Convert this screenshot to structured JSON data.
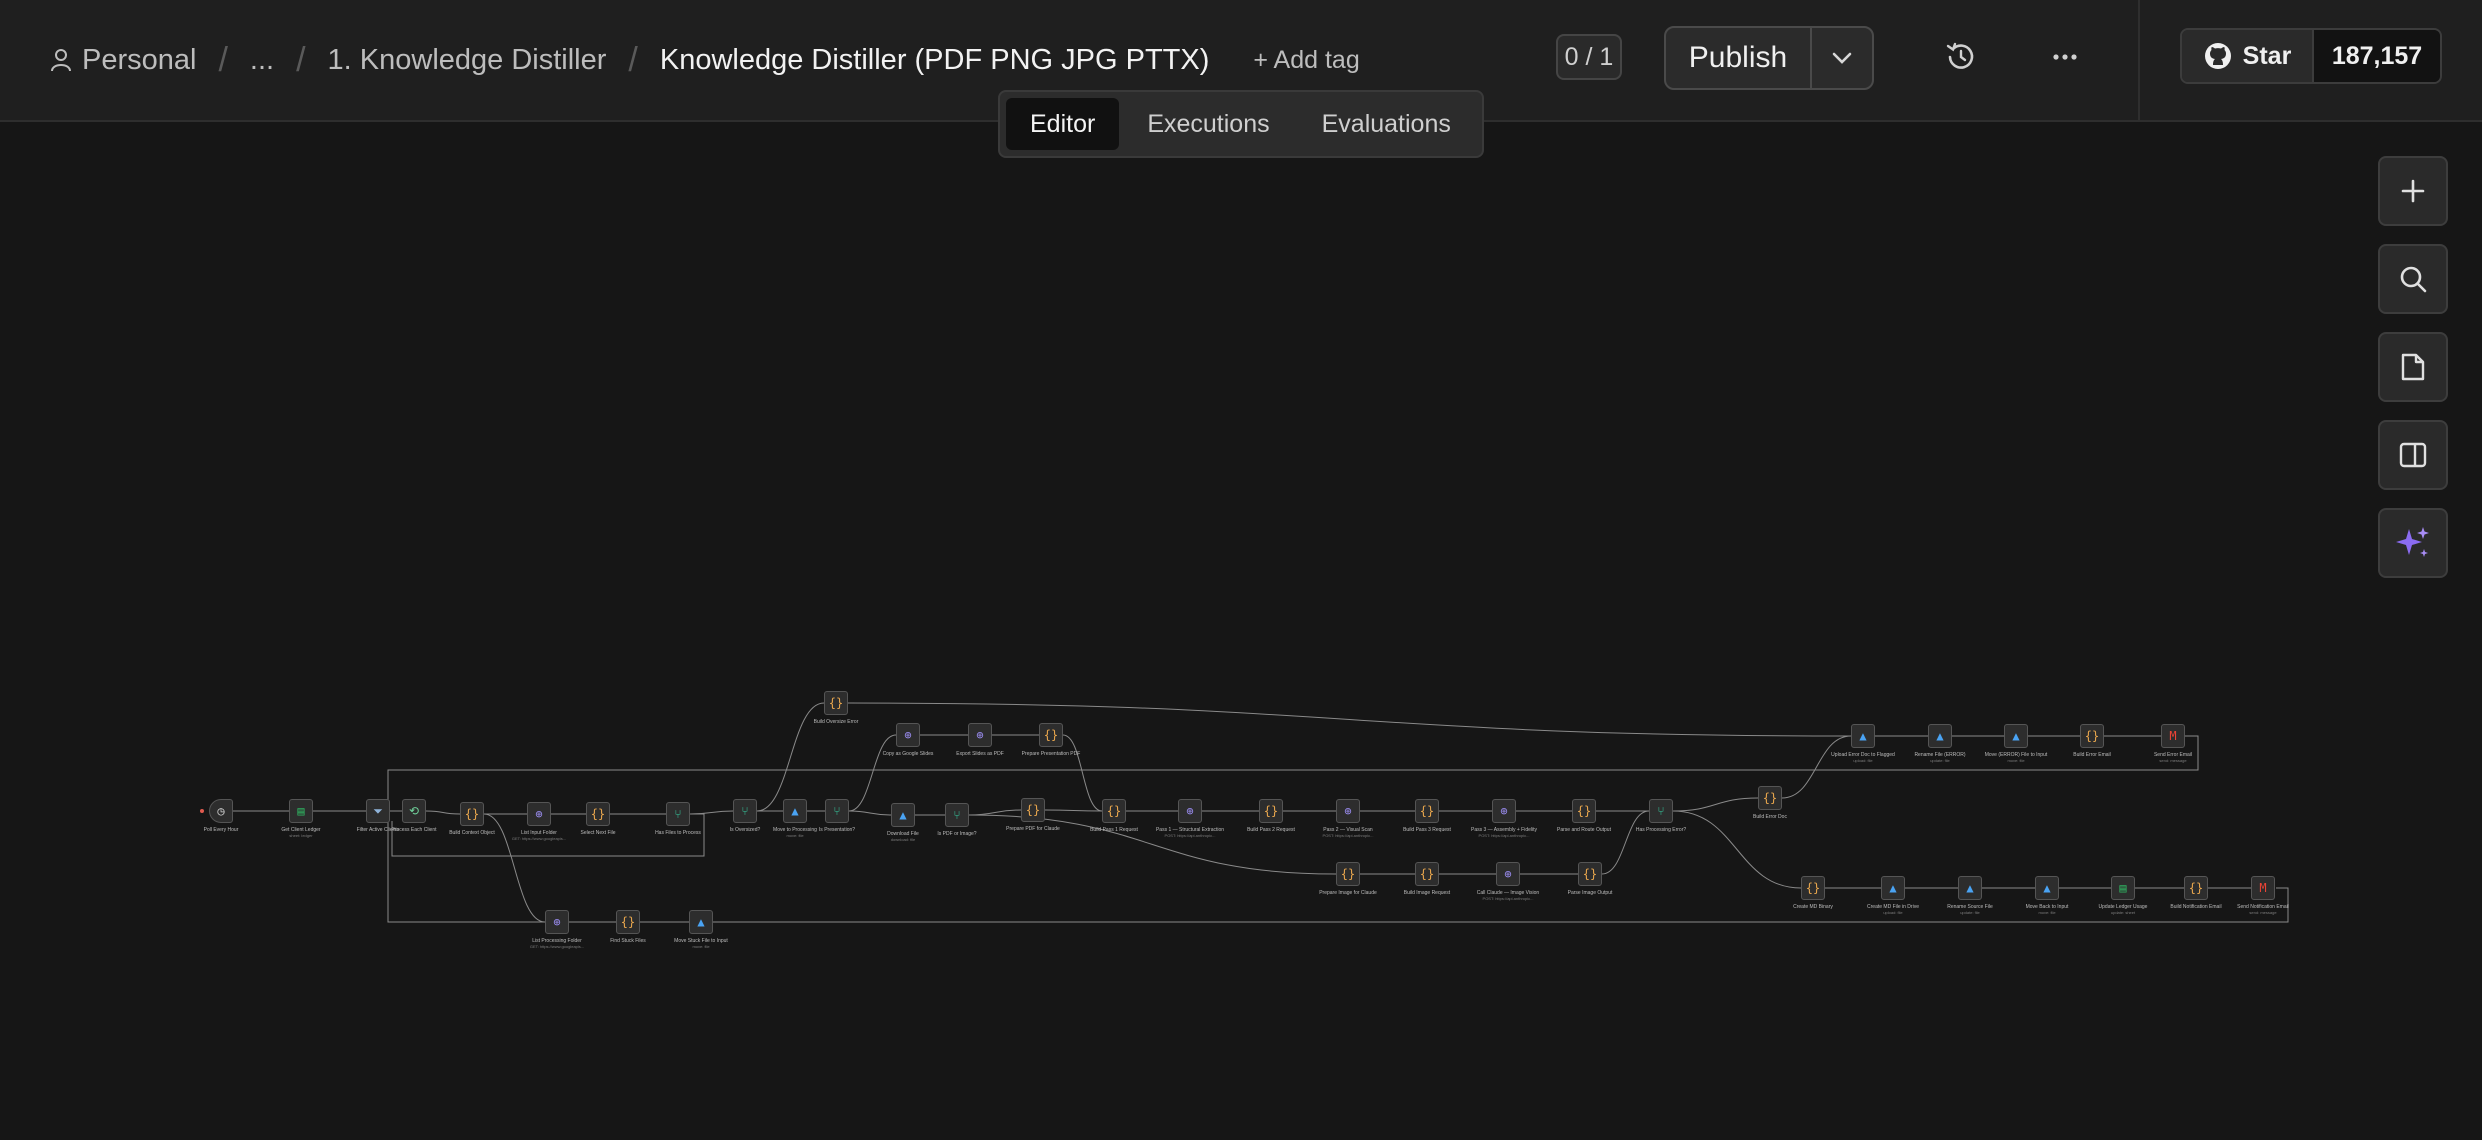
{
  "breadcrumb": {
    "personal": "Personal",
    "ellipsis": "...",
    "folder": "1. Knowledge Distiller",
    "workflow": "Knowledge Distiller (PDF PNG JPG PTTX)"
  },
  "header": {
    "add_tag": "+ Add tag",
    "counter": "0 / 1",
    "publish": "Publish",
    "github_star": "Star",
    "github_count": "187,157"
  },
  "tabs": [
    "Editor",
    "Executions",
    "Evaluations"
  ],
  "toolbar": [
    "plus-icon",
    "search-icon",
    "sticky-note-icon",
    "panel-icon",
    "ai-sparkle-icon"
  ],
  "colors": {
    "canvas": "#161616",
    "header": "#1f1f1f",
    "node": "#2d2d2d",
    "edge": "#8a8a8a",
    "accent_purple": "#8b6cf2",
    "code_orange": "#e8a64d",
    "http_purple": "#9a8cf0",
    "sheets_green": "#2fae5f",
    "drive_blue": "#4aa3f3",
    "gmail_red": "#ea4335"
  },
  "nodes": [
    {
      "id": "n1",
      "label": "Poll Every Hour",
      "sub": "",
      "kind": "trigger"
    },
    {
      "id": "n2",
      "label": "Get Client Ledger",
      "sub": "sheet: ledger",
      "kind": "sheets"
    },
    {
      "id": "n3",
      "label": "Filter Active Clients",
      "sub": "",
      "kind": "filter"
    },
    {
      "id": "n4",
      "label": "Process Each Client",
      "sub": "",
      "kind": "loop"
    },
    {
      "id": "n5",
      "label": "Build Context Object",
      "sub": "",
      "kind": "code"
    },
    {
      "id": "n6",
      "label": "List Input Folder",
      "sub": "GET: https://www.googleapis...",
      "kind": "http"
    },
    {
      "id": "n7",
      "label": "Select Next File",
      "sub": "",
      "kind": "code"
    },
    {
      "id": "n8",
      "label": "Has Files to Process",
      "sub": "",
      "kind": "if"
    },
    {
      "id": "n9",
      "label": "Is Oversized?",
      "sub": "",
      "kind": "if"
    },
    {
      "id": "n10",
      "label": "Move to Processing",
      "sub": "move: file",
      "kind": "drive"
    },
    {
      "id": "n11",
      "label": "Is Presentation?",
      "sub": "",
      "kind": "if"
    },
    {
      "id": "n12",
      "label": "Build Oversize Error",
      "sub": "",
      "kind": "code"
    },
    {
      "id": "n13",
      "label": "Copy as Google Slides",
      "sub": "",
      "kind": "http"
    },
    {
      "id": "n14",
      "label": "Export Slides as PDF",
      "sub": "",
      "kind": "http"
    },
    {
      "id": "n15",
      "label": "Prepare Presentation PDF",
      "sub": "",
      "kind": "code"
    },
    {
      "id": "n16",
      "label": "Download File",
      "sub": "download: file",
      "kind": "drive"
    },
    {
      "id": "n17",
      "label": "Is PDF or Image?",
      "sub": "",
      "kind": "if"
    },
    {
      "id": "n18",
      "label": "Prepare PDF for Claude",
      "sub": "",
      "kind": "code"
    },
    {
      "id": "n19",
      "label": "Build Pass 1 Request",
      "sub": "",
      "kind": "code"
    },
    {
      "id": "n20",
      "label": "Pass 1 — Structural Extraction",
      "sub": "POST: https://api.anthropic...",
      "kind": "http"
    },
    {
      "id": "n21",
      "label": "Build Pass 2 Request",
      "sub": "",
      "kind": "code"
    },
    {
      "id": "n22",
      "label": "Pass 2 — Visual Scan",
      "sub": "POST: https://api.anthropic...",
      "kind": "http"
    },
    {
      "id": "n23",
      "label": "Build Pass 3 Request",
      "sub": "",
      "kind": "code"
    },
    {
      "id": "n24",
      "label": "Pass 3 — Assembly + Fidelity",
      "sub": "POST: https://api.anthropic...",
      "kind": "http"
    },
    {
      "id": "n25",
      "label": "Parse and Route Output",
      "sub": "",
      "kind": "code"
    },
    {
      "id": "n26",
      "label": "Has Processing Error?",
      "sub": "",
      "kind": "if"
    },
    {
      "id": "n27",
      "label": "Build Error Doc",
      "sub": "",
      "kind": "code"
    },
    {
      "id": "n28",
      "label": "Upload Error Doc to Flagged",
      "sub": "upload: file",
      "kind": "drive"
    },
    {
      "id": "n29",
      "label": "Rename File (ERROR)",
      "sub": "update: file",
      "kind": "drive"
    },
    {
      "id": "n30",
      "label": "Move (ERROR) File to Input",
      "sub": "move: file",
      "kind": "drive"
    },
    {
      "id": "n31",
      "label": "Build Error Email",
      "sub": "",
      "kind": "code"
    },
    {
      "id": "n32",
      "label": "Send Error Email",
      "sub": "send: message",
      "kind": "gmail"
    },
    {
      "id": "n33",
      "label": "Prepare Image for Claude",
      "sub": "",
      "kind": "code"
    },
    {
      "id": "n34",
      "label": "Build Image Request",
      "sub": "",
      "kind": "code"
    },
    {
      "id": "n35",
      "label": "Call Claude — Image Vision",
      "sub": "POST: https://api.anthropic...",
      "kind": "http"
    },
    {
      "id": "n36",
      "label": "Parse Image Output",
      "sub": "",
      "kind": "code"
    },
    {
      "id": "n37",
      "label": "Create MD Binary",
      "sub": "",
      "kind": "code"
    },
    {
      "id": "n38",
      "label": "Create MD File in Drive",
      "sub": "upload: file",
      "kind": "drive"
    },
    {
      "id": "n39",
      "label": "Rename Source File",
      "sub": "update: file",
      "kind": "drive"
    },
    {
      "id": "n40",
      "label": "Move Back to Input",
      "sub": "move: file",
      "kind": "drive"
    },
    {
      "id": "n41",
      "label": "Update Ledger Usage",
      "sub": "update: sheet",
      "kind": "sheets"
    },
    {
      "id": "n42",
      "label": "Build Notification Email",
      "sub": "",
      "kind": "code"
    },
    {
      "id": "n43",
      "label": "Send Notification Email",
      "sub": "send: message",
      "kind": "gmail"
    },
    {
      "id": "n44",
      "label": "List Processing Folder",
      "sub": "GET: https://www.googleapis...",
      "kind": "http"
    },
    {
      "id": "n45",
      "label": "Find Stuck Files",
      "sub": "",
      "kind": "code"
    },
    {
      "id": "n46",
      "label": "Move Stuck File to Input",
      "sub": "move: file",
      "kind": "drive"
    }
  ]
}
